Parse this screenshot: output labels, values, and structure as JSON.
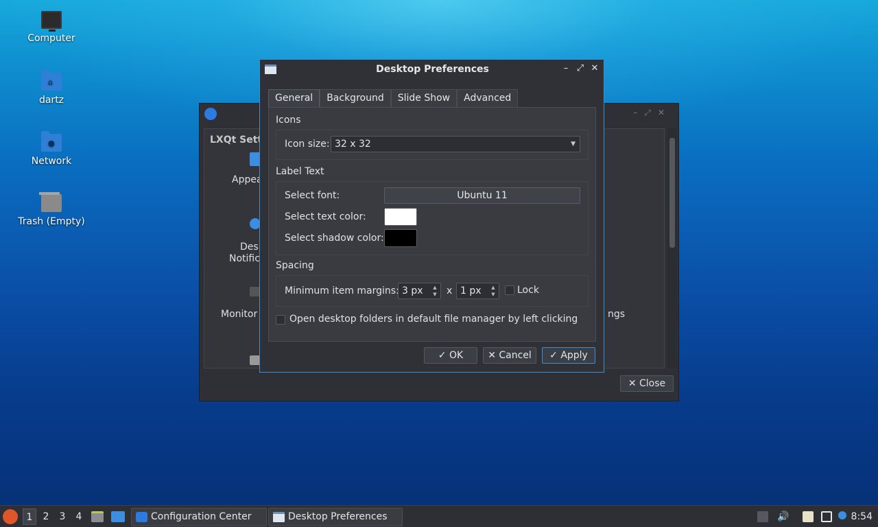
{
  "desktop": {
    "icons": [
      {
        "label": "Computer",
        "icon": "computer-icon"
      },
      {
        "label": "dartz",
        "icon": "home-folder-icon"
      },
      {
        "label": "Network",
        "icon": "network-folder-icon"
      },
      {
        "label": "Trash (Empty)",
        "icon": "trash-icon"
      }
    ]
  },
  "settings_window": {
    "heading": "LXQt Setti",
    "items": [
      "Appea",
      "Desk",
      "Notific",
      "Monitor",
      "ngs"
    ],
    "close_label": "✕ Close"
  },
  "dialog": {
    "title": "Desktop Preferences",
    "controls": {
      "minimize": "–",
      "maximize": "⤢",
      "close": "✕"
    },
    "tabs": [
      "General",
      "Background",
      "Slide Show",
      "Advanced"
    ],
    "active_tab": "General",
    "icons_group": {
      "title": "Icons",
      "icon_size_label": "Icon size:",
      "icon_size_value": "32 x 32"
    },
    "label_text_group": {
      "title": "Label Text",
      "font_label": "Select font:",
      "font_value": "Ubuntu 11",
      "text_color_label": "Select text color:",
      "text_color": "#ffffff",
      "shadow_color_label": "Select shadow color:",
      "shadow_color": "#000000"
    },
    "spacing_group": {
      "title": "Spacing",
      "margins_label": "Minimum item margins:",
      "margin_x": "3 px",
      "separator": "x",
      "margin_y": "1 px",
      "lock_label": "Lock"
    },
    "open_folders_label": "Open desktop folders in default file manager by left clicking",
    "buttons": {
      "ok": "✓ OK",
      "cancel": "✕ Cancel",
      "apply": "✓ Apply"
    }
  },
  "taskbar": {
    "desktops": [
      "1",
      "2",
      "3",
      "4"
    ],
    "active_desktop": "1",
    "tasks": [
      {
        "label": "Configuration Center",
        "icon": "configuration-center-icon"
      },
      {
        "label": "Desktop Preferences",
        "icon": "desktop-preferences-icon"
      }
    ],
    "clock": "8:54"
  },
  "colors": {
    "accent": "#3d8fd1",
    "window_bg": "#2f3136",
    "taskbar_bg": "#2d2f34"
  }
}
